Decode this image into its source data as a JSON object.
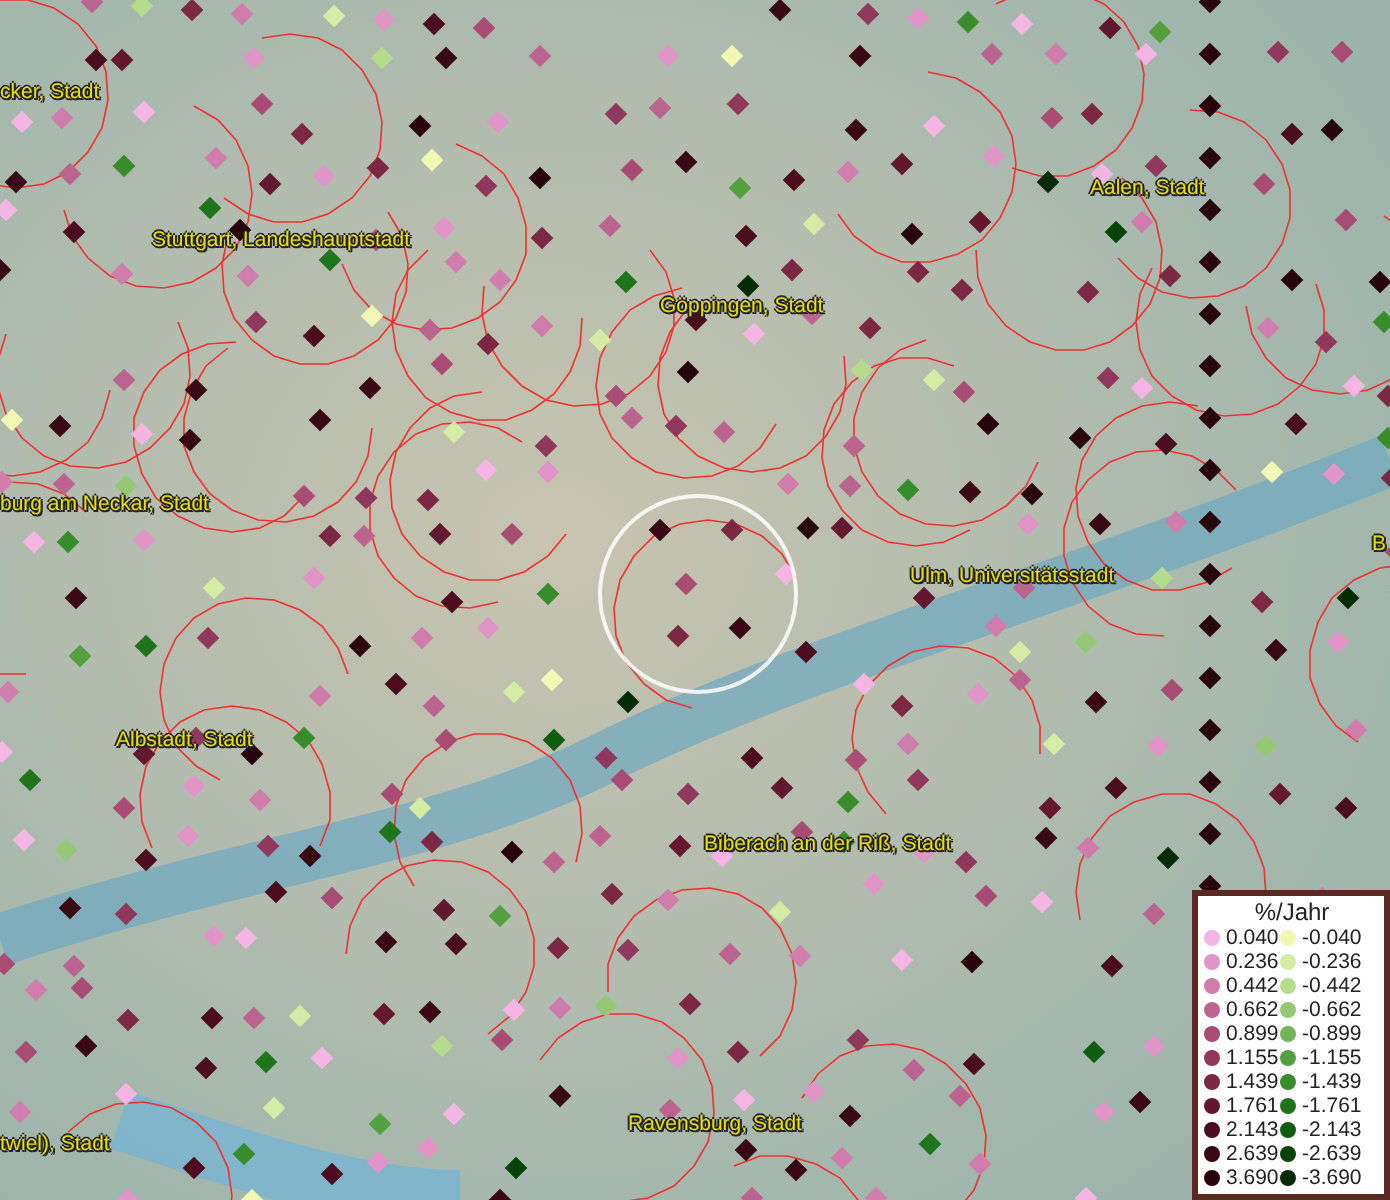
{
  "map": {
    "labels": [
      {
        "text": "cker, Stadt"
      },
      {
        "text": "Stuttgart, Landeshauptstadt"
      },
      {
        "text": "Göppingen, Stadt"
      },
      {
        "text": "Aalen, Stadt"
      },
      {
        "text": "burg am Neckar, Stadt"
      },
      {
        "text": "Ulm, Universitätsstadt"
      },
      {
        "text": "B"
      },
      {
        "text": "Albstadt, Stadt"
      },
      {
        "text": "Biberach an der Riß, Stadt"
      },
      {
        "text": "twiel), Stadt"
      },
      {
        "text": "Ravensburg, Stadt"
      }
    ]
  },
  "legend": {
    "title": "%/Jahr",
    "rows": [
      {
        "positive": {
          "label": "0.040",
          "color": "#f4b4e4"
        },
        "negative": {
          "label": "-0.040",
          "color": "#f0f8b4"
        }
      },
      {
        "positive": {
          "label": "0.236",
          "color": "#e094c8"
        },
        "negative": {
          "label": "-0.236",
          "color": "#d4eca4"
        }
      },
      {
        "positive": {
          "label": "0.442",
          "color": "#d07cac"
        },
        "negative": {
          "label": "-0.442",
          "color": "#b4dc8c"
        }
      },
      {
        "positive": {
          "label": "0.662",
          "color": "#bc6490"
        },
        "negative": {
          "label": "-0.662",
          "color": "#94c874"
        }
      },
      {
        "positive": {
          "label": "0.899",
          "color": "#a84c74"
        },
        "negative": {
          "label": "-0.899",
          "color": "#74b458"
        }
      },
      {
        "positive": {
          "label": "1.155",
          "color": "#90385c"
        },
        "negative": {
          "label": "-1.155",
          "color": "#54a040"
        }
      },
      {
        "positive": {
          "label": "1.439",
          "color": "#7c2844"
        },
        "negative": {
          "label": "-1.439",
          "color": "#388c2c"
        }
      },
      {
        "positive": {
          "label": "1.761",
          "color": "#641830"
        },
        "negative": {
          "label": "-1.761",
          "color": "#20741c"
        }
      },
      {
        "positive": {
          "label": "2.143",
          "color": "#4c0c20"
        },
        "negative": {
          "label": "-2.143",
          "color": "#105c10"
        }
      },
      {
        "positive": {
          "label": "2.639",
          "color": "#380814"
        },
        "negative": {
          "label": "-2.639",
          "color": "#084408"
        }
      },
      {
        "positive": {
          "label": "3.690",
          "color": "#28040c"
        },
        "negative": {
          "label": "-3.690",
          "color": "#042c04"
        }
      }
    ]
  }
}
